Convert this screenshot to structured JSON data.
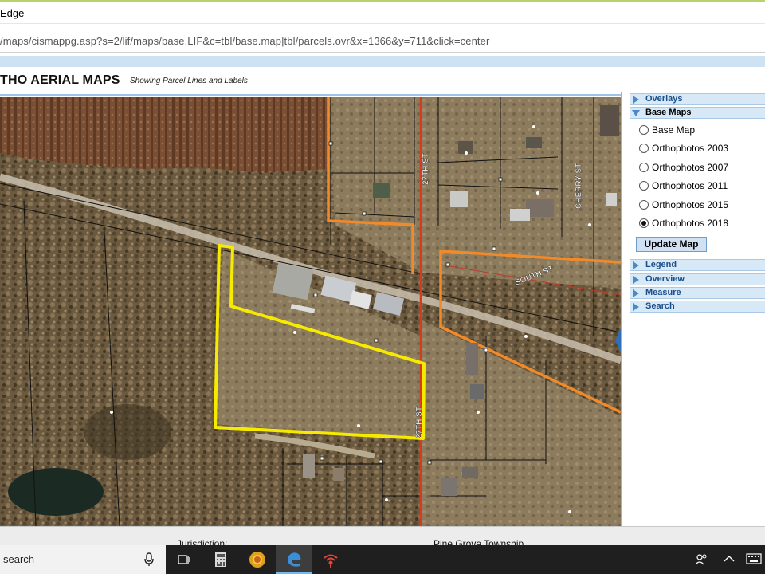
{
  "window": {
    "title": "Edge"
  },
  "address": {
    "url": "/maps/cismappg.asp?s=2/lif/maps/base.LIF&c=tbl/base.map|tbl/parcels.ovr&x=1366&y=711&click=center"
  },
  "page": {
    "strip_text": "",
    "title": "THO AERIAL MAPS",
    "subtitle": "Showing Parcel Lines and Labels"
  },
  "map": {
    "streets": [
      {
        "name": "27TH ST"
      },
      {
        "name": "CHERRY ST"
      },
      {
        "name": "SOUTH ST"
      },
      {
        "name": "27TH ST"
      }
    ],
    "colors": {
      "selected_parcel": "#f5ea00",
      "township_line": "#f08a2a",
      "road_center": "#d63a1f",
      "parcel_lines": "#111111"
    }
  },
  "panel": {
    "sections": [
      {
        "label": "Overlays",
        "expanded": false
      },
      {
        "label": "Base Maps",
        "expanded": true
      },
      {
        "label": "Legend",
        "expanded": false
      },
      {
        "label": "Overview",
        "expanded": false
      },
      {
        "label": "Measure",
        "expanded": false
      },
      {
        "label": "Search",
        "expanded": false
      }
    ],
    "base_maps": [
      {
        "label": "Base Map",
        "checked": false
      },
      {
        "label": "Orthophotos 2003",
        "checked": false
      },
      {
        "label": "Orthophotos 2007",
        "checked": false
      },
      {
        "label": "Orthophotos 2011",
        "checked": false
      },
      {
        "label": "Orthophotos 2015",
        "checked": false
      },
      {
        "label": "Orthophotos 2018",
        "checked": true
      }
    ],
    "update_button": "Update Map"
  },
  "info": {
    "jurisdiction_label": "Jurisdiction:",
    "jurisdiction_value": "Pine Grove Township"
  },
  "taskbar": {
    "search_placeholder": "search",
    "icons": [
      "task-view-icon",
      "calculator-icon",
      "chrome-icon",
      "edge-icon",
      "wifi-app-icon"
    ],
    "tray": [
      "people-icon",
      "chevron-up-icon",
      "keyboard-icon"
    ]
  }
}
